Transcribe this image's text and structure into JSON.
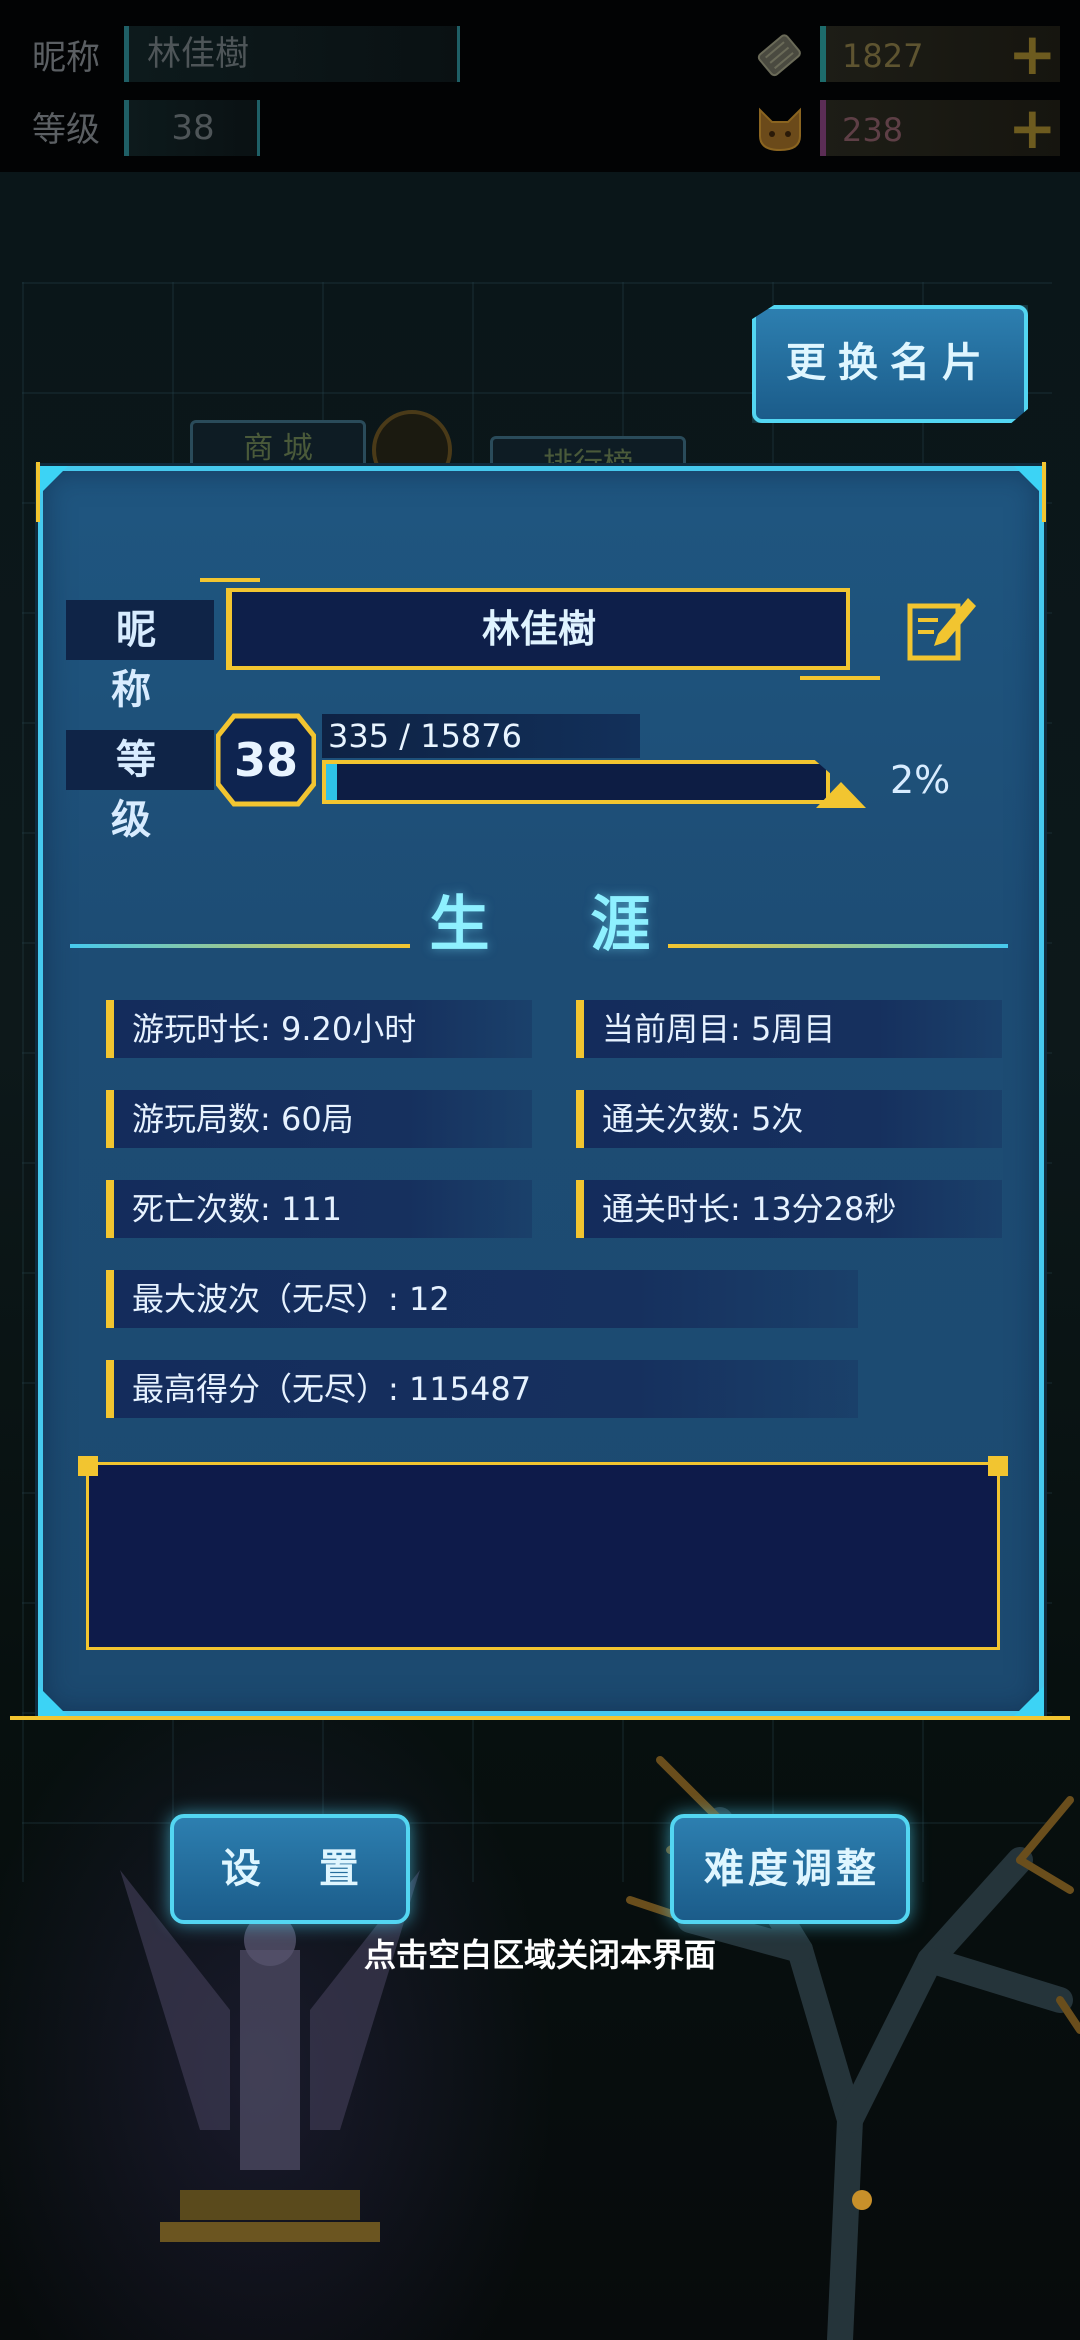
{
  "topbar": {
    "nickname_label": "昵称",
    "nickname_value": "林佳樹",
    "level_label": "等级",
    "level_value": "38",
    "coins": "1827",
    "gems": "238",
    "plus_icon": "plus-icon"
  },
  "background": {
    "tab_shop": "商 城",
    "tab_ranking": "排行榜"
  },
  "change_card_button": "更换名片",
  "profile": {
    "nickname_label": "昵 称",
    "nickname_value": "林佳樹",
    "level_label": "等 级",
    "level_value": "38",
    "xp_text": "335 / 15876",
    "xp_fraction": 0.021,
    "xp_percent": "2%"
  },
  "career": {
    "title": "生 涯",
    "stats": {
      "play_time": "游玩时长: 9.20小时",
      "current_cycle": "当前周目: 5周目",
      "play_count": "游玩局数: 60局",
      "clear_count": "通关次数: 5次",
      "death_count": "死亡次数: 111",
      "clear_time": "通关时长: 13分28秒",
      "max_wave": "最大波次（无尽）: 12",
      "high_score": "最高得分（无尽）: 115487"
    }
  },
  "buttons": {
    "settings": "设 置",
    "difficulty": "难度调整"
  },
  "hint": "点击空白区域关闭本界面",
  "colors": {
    "accent_cyan": "#46c9ee",
    "accent_gold": "#f2c530",
    "panel_blue": "#1d4c74"
  }
}
